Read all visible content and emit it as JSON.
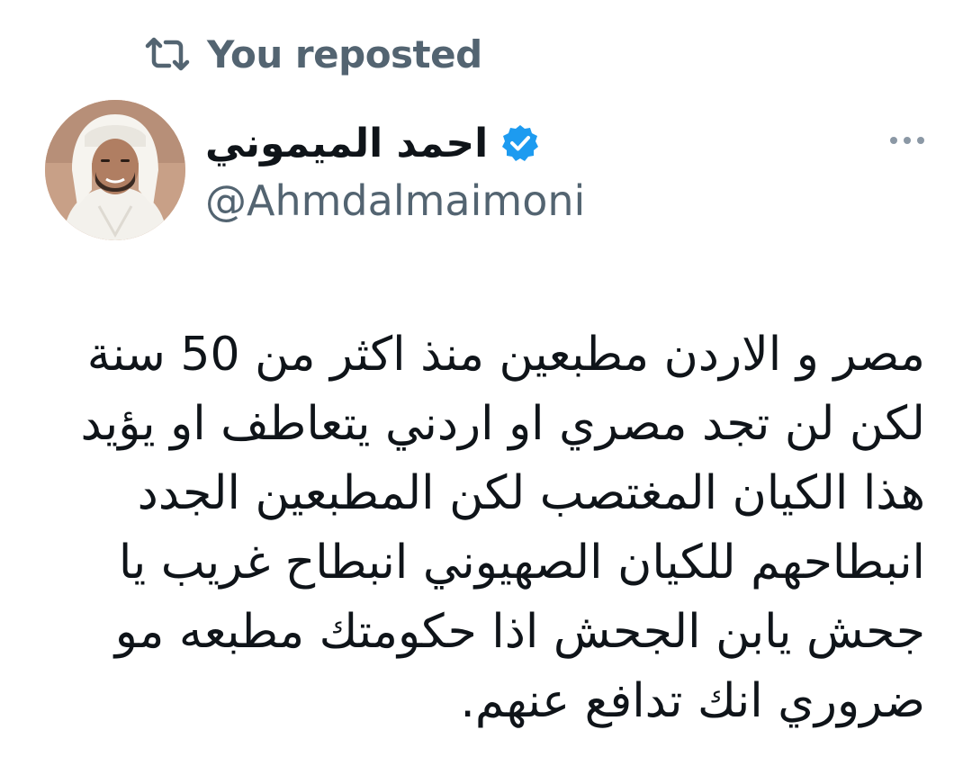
{
  "repost": {
    "icon": "repost-icon",
    "label": "You reposted"
  },
  "author": {
    "avatar_icon": "avatar-photo",
    "display_name": "احمد الميموني",
    "verified_icon": "verified-badge-icon",
    "verified_color": "#1d9bf0",
    "handle": "@Ahmdalmaimoni"
  },
  "menu": {
    "icon": "more-options-icon"
  },
  "tweet": {
    "lines": [
      "مصر و الاردن مطبعين منذ اكثر من 50 سنة",
      "لكن لن تجد مصري او اردني يتعاطف او يؤيد",
      "هذا الكيان المغتصب لكن المطبعين الجدد",
      "انبطاحهم للكيان الصهيوني انبطاح غريب يا",
      "جحش يابن الجحش اذا حكومتك مطبعه مو",
      "ضروري انك تدافع عنهم."
    ]
  },
  "colors": {
    "text_primary": "#0f1419",
    "text_secondary": "#536471",
    "accent": "#1d9bf0"
  }
}
